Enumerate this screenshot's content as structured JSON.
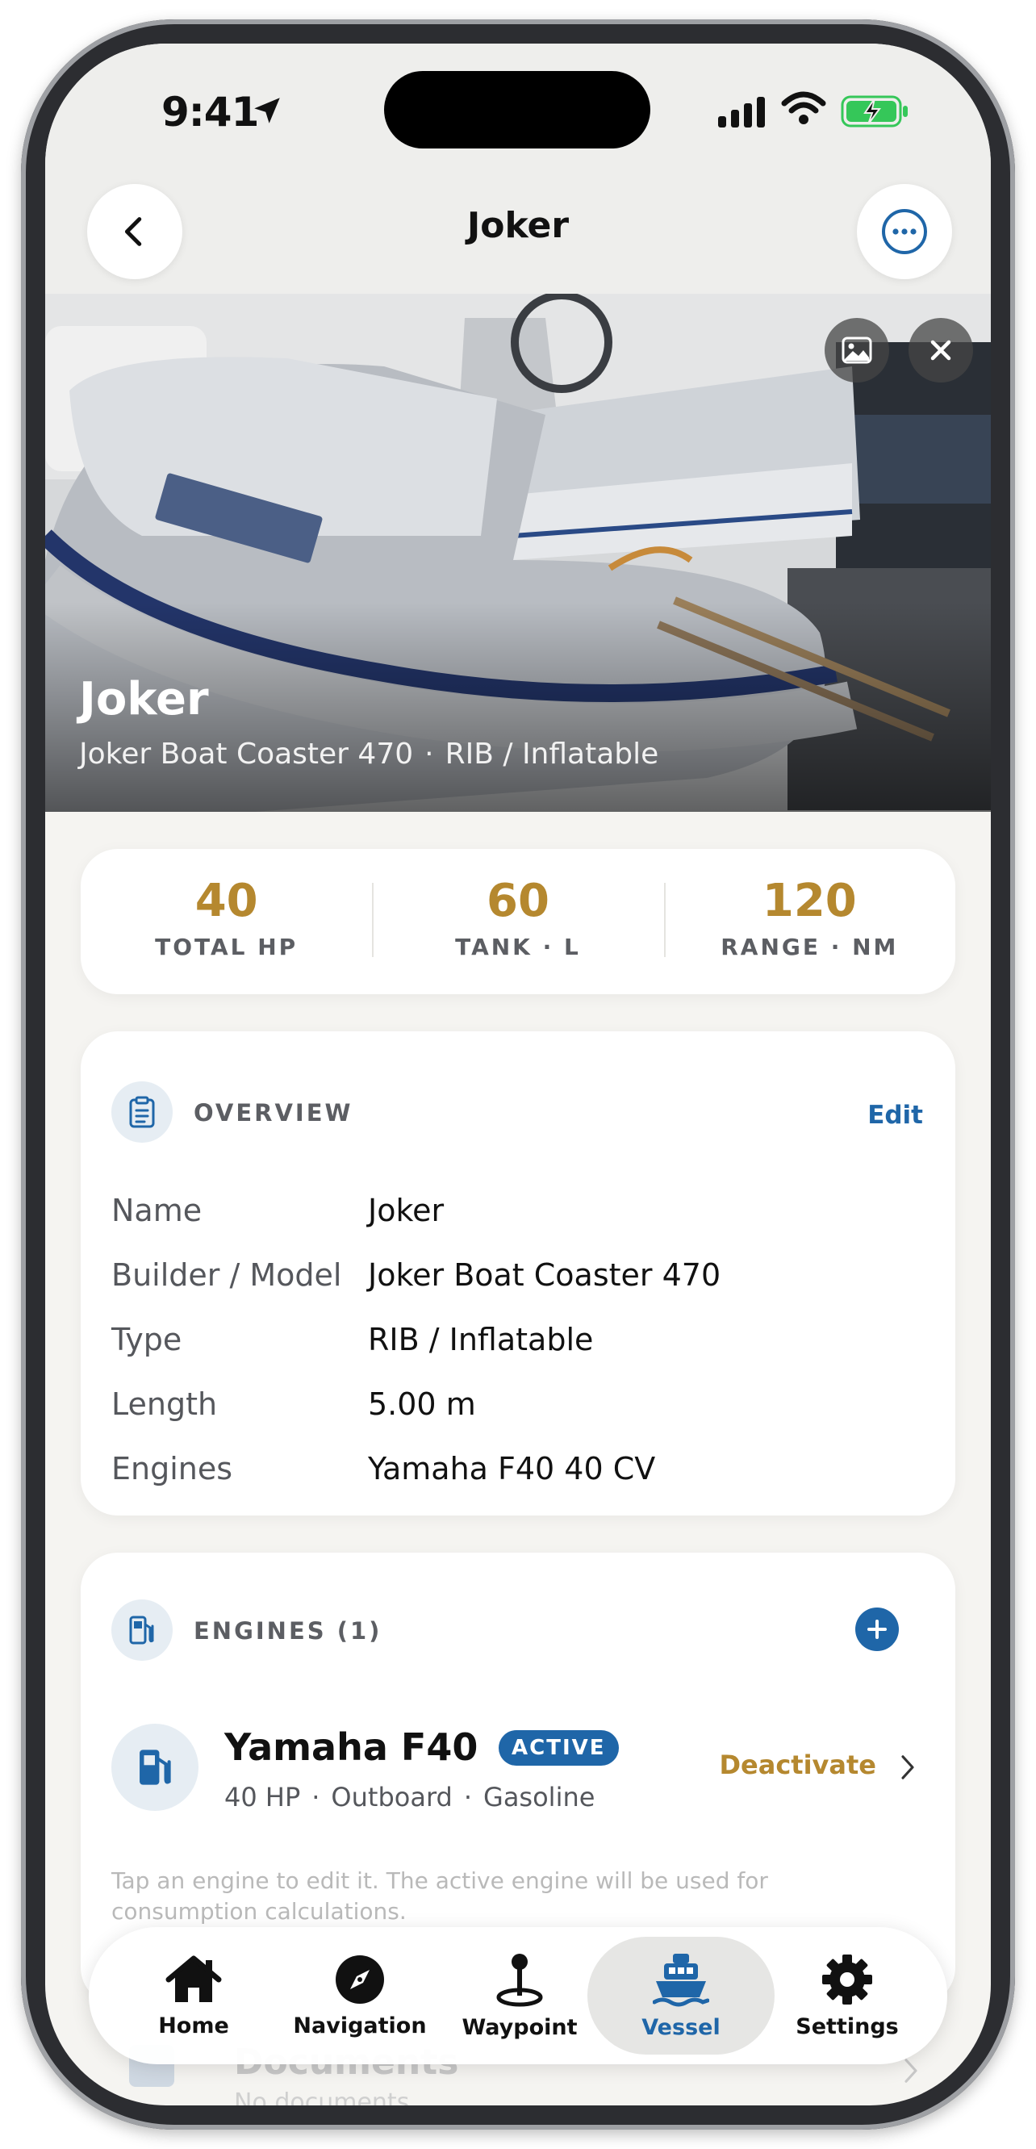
{
  "status_bar": {
    "time": "9:41"
  },
  "header": {
    "title": "Joker"
  },
  "hero": {
    "title": "Joker",
    "model": "Joker Boat Coaster 470",
    "separator": "·",
    "type": "RIB / Inflatable"
  },
  "stats": [
    {
      "value": "40",
      "label": "TOTAL HP"
    },
    {
      "value": "60",
      "label": "TANK · L"
    },
    {
      "value": "120",
      "label": "RANGE · NM"
    }
  ],
  "overview": {
    "title": "OVERVIEW",
    "edit_label": "Edit",
    "rows": [
      {
        "key": "Name",
        "value": "Joker"
      },
      {
        "key": "Builder / Model",
        "value": "Joker Boat Coaster 470"
      },
      {
        "key": "Type",
        "value": "RIB / Inflatable"
      },
      {
        "key": "Length",
        "value": "5.00 m"
      },
      {
        "key": "Engines",
        "value": "Yamaha F40 40 CV"
      }
    ]
  },
  "engines": {
    "title": "ENGINES (1)",
    "items": [
      {
        "name": "Yamaha F40",
        "badge": "ACTIVE",
        "power": "40 HP",
        "mount": "Outboard",
        "fuel": "Gasoline",
        "separator": "·",
        "action": "Deactivate"
      }
    ],
    "hint": "Tap an engine to edit it. The active engine will be used for consumption calculations."
  },
  "documents": {
    "title": "Documents",
    "subtitle": "No documents"
  },
  "tabbar": {
    "items": [
      {
        "label": "Home"
      },
      {
        "label": "Navigation"
      },
      {
        "label": "Waypoint"
      },
      {
        "label": "Vessel",
        "selected": true
      },
      {
        "label": "Settings"
      }
    ]
  },
  "colors": {
    "accent_blue": "#1f66a8",
    "accent_gold": "#b5882f",
    "background": "#f5f4f1",
    "battery_green": "#35c759"
  }
}
